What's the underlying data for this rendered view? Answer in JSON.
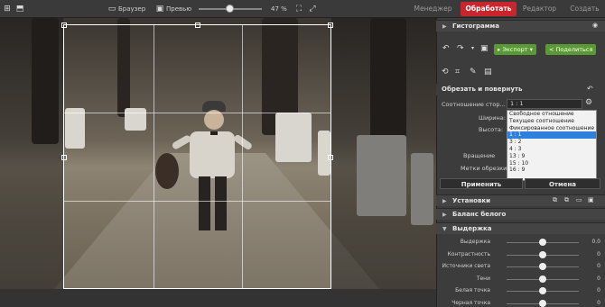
{
  "topbar": {
    "browser_label": "Браузер",
    "preview_label": "Превью",
    "zoom": "47 %",
    "zoom_fraction": 0.5,
    "tabs": [
      "Менеджер",
      "Обработать",
      "Редактор",
      "Создать"
    ],
    "active_tab_color": "#c8262c"
  },
  "panel": {
    "histogram_title": "Гистограмма",
    "export_label": "Экспорт",
    "share_label": "Поделиться",
    "crop_section_title": "Обрезать и повернуть",
    "ratio_label": "Соотношение стор...",
    "ratio_value": "1 : 1",
    "width_label": "Ширина:",
    "height_label": "Высота:",
    "rotate_label": "Вращение",
    "crop_marks_label": "Метки обрезки",
    "apply_label": "Применить",
    "cancel_label": "Отмена",
    "sections": {
      "settings": "Установки",
      "white_balance": "Баланс белого",
      "exposure": "Выдержка"
    },
    "accent_green": "#5a9a35"
  },
  "dropdown": {
    "options": [
      "Свободное отношение",
      "Текущее соотношение",
      "Фиксированное соотношение",
      "1 : 1",
      "3 : 2",
      "4 : 3",
      "13 : 9",
      "15 : 10",
      "16 : 9"
    ],
    "selected": "1 : 1",
    "selected_color": "#2f7fdf"
  },
  "adjustments": [
    {
      "label": "Выдержка",
      "value": "0.0",
      "level": 0.5
    },
    {
      "label": "Контрастность",
      "value": "0",
      "level": 0.5
    },
    {
      "label": "Источники света",
      "value": "0",
      "level": 0.5
    },
    {
      "label": "Тени",
      "value": "0",
      "level": 0.5
    },
    {
      "label": "Белая точка",
      "value": "0",
      "level": 0.5
    },
    {
      "label": "Черная точка",
      "value": "0",
      "level": 0.5
    }
  ]
}
